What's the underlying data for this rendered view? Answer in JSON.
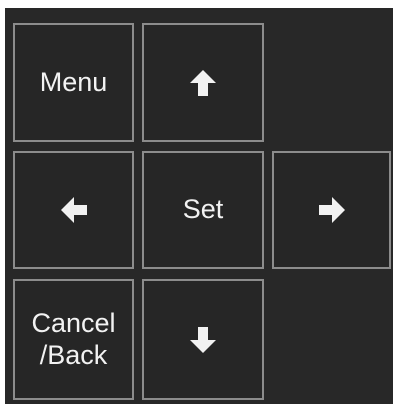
{
  "remote": {
    "menu_label": "Menu",
    "set_label": "Set",
    "cancel_back_label": "Cancel\n/Back",
    "up_icon": "arrow-up",
    "down_icon": "arrow-down",
    "left_icon": "arrow-left",
    "right_icon": "arrow-right"
  },
  "colors": {
    "panel_background": "#282828",
    "button_border": "#8c8c8c",
    "text_and_icons": "#f2f2f2"
  }
}
